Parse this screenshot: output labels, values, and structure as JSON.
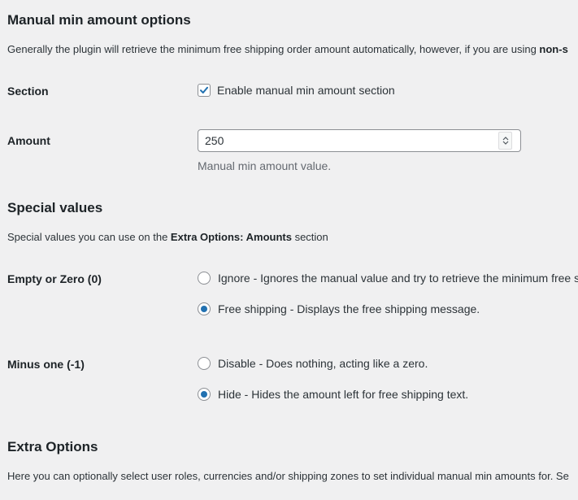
{
  "manual_section": {
    "title": "Manual min amount options",
    "description_prefix": "Generally the plugin will retrieve the minimum free shipping order amount automatically, however, if you are using ",
    "description_bold": "non-s"
  },
  "section_row": {
    "label": "Section",
    "checkbox_label": "Enable manual min amount section",
    "checked": true
  },
  "amount_row": {
    "label": "Amount",
    "value": "250",
    "help": "Manual min amount value."
  },
  "special_values": {
    "title": "Special values",
    "description_prefix": "Special values you can use on the ",
    "description_bold": "Extra Options: Amounts",
    "description_suffix": " section"
  },
  "empty_or_zero": {
    "label": "Empty or Zero (0)",
    "options": [
      {
        "label": "Ignore - Ignores the manual value and try to retrieve the minimum free s",
        "selected": false
      },
      {
        "label": "Free shipping - Displays the free shipping message.",
        "selected": true
      }
    ]
  },
  "minus_one": {
    "label": "Minus one (-1)",
    "options": [
      {
        "label": "Disable - Does nothing, acting like a zero.",
        "selected": false
      },
      {
        "label": "Hide - Hides the amount left for free shipping text.",
        "selected": true
      }
    ]
  },
  "extra_options": {
    "title": "Extra Options",
    "description": "Here you can optionally select user roles, currencies and/or shipping zones to set individual manual min amounts for. Se"
  },
  "colors": {
    "accent": "#2271b1",
    "background": "#f0f0f1",
    "text": "#1d2327",
    "muted": "#646970"
  }
}
